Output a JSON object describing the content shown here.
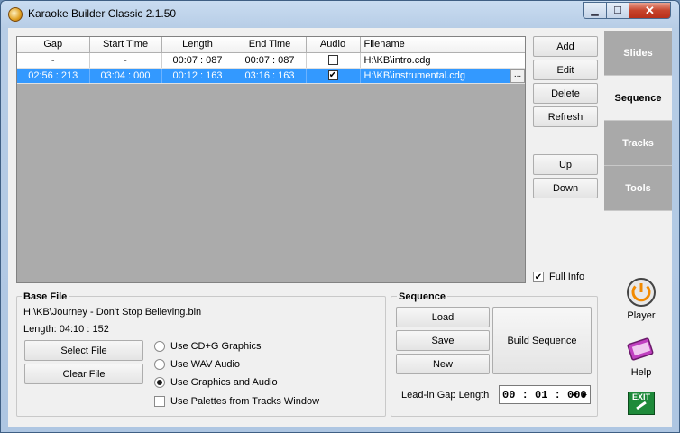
{
  "window": {
    "title": "Karaoke Builder Classic 2.1.50",
    "min": "▁",
    "max": "☐",
    "close": "✕"
  },
  "grid": {
    "columns": [
      "Gap",
      "Start Time",
      "Length",
      "End Time",
      "Audio",
      "Filename"
    ],
    "rows": [
      {
        "gap": "-",
        "start": "-",
        "length": "00:07 : 087",
        "end": "00:07 : 087",
        "audio": "",
        "filename": "H:\\KB\\intro.cdg"
      },
      {
        "gap": "02:56 : 213",
        "start": "03:04 : 000",
        "length": "00:12 : 163",
        "end": "03:16 : 163",
        "audio": "✔",
        "filename": "H:\\KB\\instrumental.cdg",
        "ellipsis": "..."
      }
    ]
  },
  "buttons": {
    "add": "Add",
    "edit": "Edit",
    "delete": "Delete",
    "refresh": "Refresh",
    "up": "Up",
    "down": "Down"
  },
  "full_info": {
    "label": "Full Info",
    "check": "✔"
  },
  "tabs": [
    "Slides",
    "Sequence",
    "Tracks",
    "Tools"
  ],
  "side": {
    "player": "Player",
    "help": "Help",
    "exit": "EXIT"
  },
  "base_file": {
    "title": "Base File",
    "path": "H:\\KB\\Journey - Don't Stop Believing.bin",
    "length": "Length: 04:10 : 152",
    "select": "Select File",
    "clear": "Clear File",
    "options": [
      "Use CD+G Graphics",
      "Use WAV Audio",
      "Use Graphics and Audio"
    ],
    "palettes": "Use Palettes from Tracks Window"
  },
  "sequence": {
    "title": "Sequence",
    "load": "Load",
    "save": "Save",
    "new": "New",
    "build": "Build Sequence",
    "leadin_label": "Lead-in Gap Length",
    "leadin_value": "00 : 01 : 000",
    "spin_left": "◀",
    "spin_right": "▶"
  }
}
